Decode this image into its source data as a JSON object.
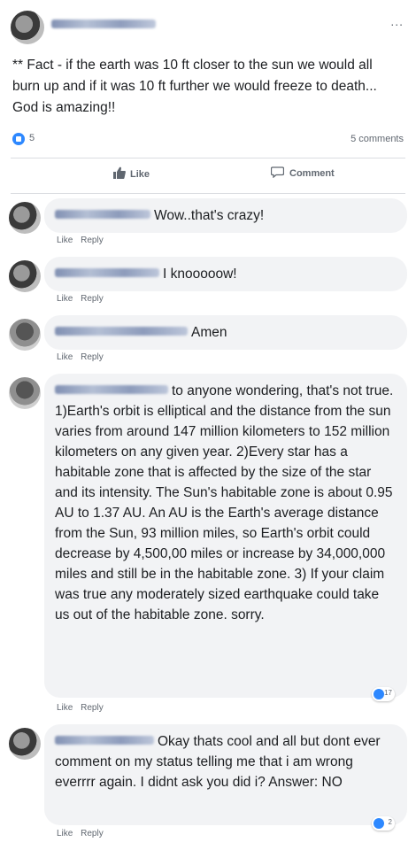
{
  "post": {
    "more_label": "...",
    "text": "** Fact - if the earth was 10 ft closer to the sun we would all burn up and if it was 10 ft further we would freeze to death... God is amazing!!",
    "reaction_count": "5",
    "comments_count": "5 comments"
  },
  "actions": {
    "like_label": "Like",
    "comment_label": "Comment"
  },
  "comments": [
    {
      "text": "Wow..that's crazy!",
      "like_label": "Like",
      "reply_label": "Reply"
    },
    {
      "text": "I knooooow!",
      "like_label": "Like",
      "reply_label": "Reply"
    },
    {
      "text": "Amen",
      "like_label": "Like",
      "reply_label": "Reply"
    },
    {
      "text": "to anyone wondering, that's not true. 1)Earth's orbit is elliptical and the distance from the sun varies from around 147 million kilometers to 152 million kilometers on any given year. 2)Every star has a habitable zone that is affected by the size of the star and its intensity. The Sun's habitable zone is about 0.95 AU to 1.37 AU. An AU is the Earth's average distance from the Sun, 93 million miles, so Earth's orbit could decrease by 4,500,00 miles or increase by 34,000,000 miles and still be in the habitable zone. 3) If your claim was true any moderately sized earthquake could take us out of the habitable zone. sorry.",
      "like_label": "Like",
      "reply_label": "Reply",
      "reactions": "17"
    },
    {
      "text": "Okay thats cool and all but dont ever comment on my status telling me that i am wrong everrrr again. I didnt ask you did i? Answer: NO",
      "like_label": "Like",
      "reply_label": "Reply",
      "reactions": "2"
    }
  ],
  "colors": {
    "accent": "#2d88ff",
    "bubble": "#f2f3f5",
    "meta": "#606770"
  }
}
